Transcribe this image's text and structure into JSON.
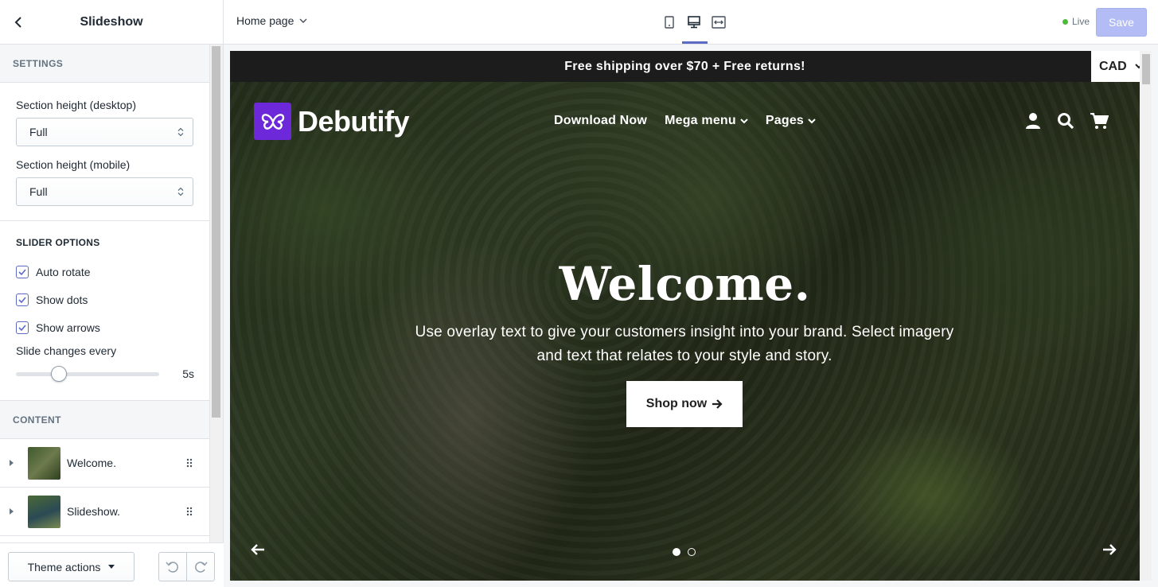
{
  "sidebar": {
    "title": "Slideshow",
    "settings_heading": "SETTINGS",
    "section_height_desktop_label": "Section height (desktop)",
    "section_height_desktop_value": "Full",
    "section_height_mobile_label": "Section height (mobile)",
    "section_height_mobile_value": "Full",
    "slider_options_heading": "SLIDER OPTIONS",
    "options": [
      {
        "label": "Auto rotate",
        "checked": true
      },
      {
        "label": "Show dots",
        "checked": true
      },
      {
        "label": "Show arrows",
        "checked": true
      }
    ],
    "slide_changes_label": "Slide changes every",
    "slide_changes_value": "5s",
    "slide_changes_slider_fraction": 0.3,
    "content_heading": "CONTENT",
    "content_items": [
      {
        "label": "Welcome.",
        "icon": "drag-handle-icon"
      },
      {
        "label": "Slideshow.",
        "icon": "drag-handle-icon"
      }
    ],
    "theme_actions_label": "Theme actions"
  },
  "topbar": {
    "page_select": "Home page",
    "live_label": "Live",
    "save_label": "Save",
    "devices": [
      "mobile-icon",
      "desktop-icon",
      "fullscreen-icon"
    ],
    "active_device": "desktop-icon"
  },
  "preview": {
    "announcement": "Free shipping over $70 + Free returns!",
    "currency": "CAD",
    "logo_text": "Debutify",
    "nav": [
      {
        "label": "Download Now",
        "dropdown": false
      },
      {
        "label": "Mega menu",
        "dropdown": true
      },
      {
        "label": "Pages",
        "dropdown": true
      }
    ],
    "hero_title": "Welcome.",
    "hero_text": "Use overlay text to give your customers insight into your brand. Select imagery and text that relates to your style and story.",
    "cta_label": "Shop now",
    "slide_count": 2,
    "active_slide": 1
  },
  "colors": {
    "accent": "#5c6ac4",
    "save_disabled": "#b3bcf5",
    "live": "#50b83c",
    "logo": "#6d28d9",
    "announcement_bg": "#1c1c1c"
  }
}
